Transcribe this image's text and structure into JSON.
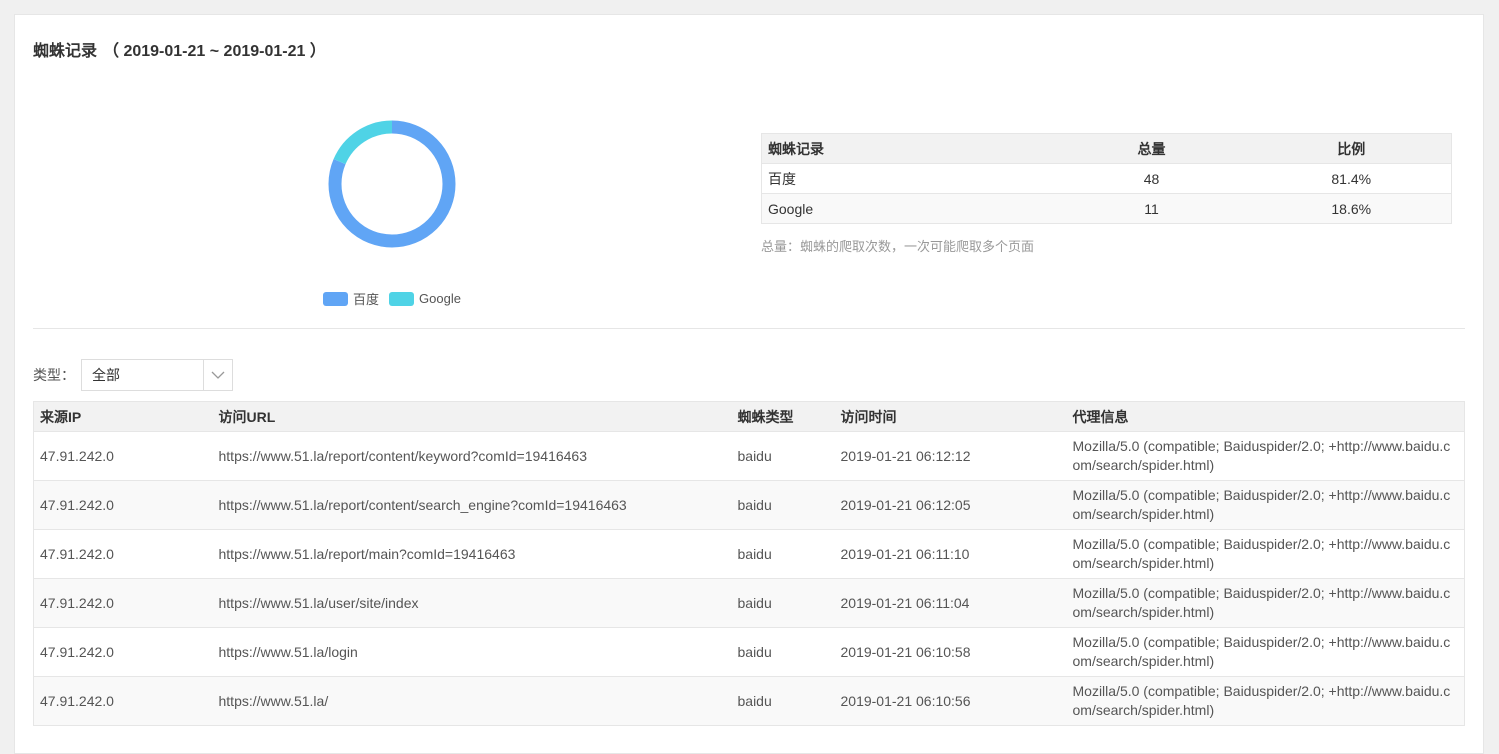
{
  "header": {
    "title": "蜘蛛记录",
    "date_range": "（ 2019-01-21 ~ 2019-01-21 ）"
  },
  "chart_data": {
    "type": "pie",
    "donut": true,
    "categories": [
      "百度",
      "Google"
    ],
    "values": [
      48,
      11
    ],
    "colors": [
      "#60a5f5",
      "#4fd3e6"
    ],
    "legend_position": "bottom"
  },
  "summary": {
    "headers": [
      "蜘蛛记录",
      "总量",
      "比例"
    ],
    "rows": [
      [
        "百度",
        "48",
        "81.4%"
      ],
      [
        "Google",
        "11",
        "18.6%"
      ]
    ],
    "note": "总量：蜘蛛的爬取次数，一次可能爬取多个页面"
  },
  "filter": {
    "label": "类型：",
    "selected": "全部"
  },
  "log": {
    "headers": [
      "来源IP",
      "访问URL",
      "蜘蛛类型",
      "访问时间",
      "代理信息"
    ],
    "rows": [
      [
        "47.91.242.0",
        "https://www.51.la/report/content/keyword?comId=19416463",
        "baidu",
        "2019-01-21 06:12:12",
        "Mozilla/5.0 (compatible; Baiduspider/2.0; +http://www.baidu.com/search/spider.html)"
      ],
      [
        "47.91.242.0",
        "https://www.51.la/report/content/search_engine?comId=19416463",
        "baidu",
        "2019-01-21 06:12:05",
        "Mozilla/5.0 (compatible; Baiduspider/2.0; +http://www.baidu.com/search/spider.html)"
      ],
      [
        "47.91.242.0",
        "https://www.51.la/report/main?comId=19416463",
        "baidu",
        "2019-01-21 06:11:10",
        "Mozilla/5.0 (compatible; Baiduspider/2.0; +http://www.baidu.com/search/spider.html)"
      ],
      [
        "47.91.242.0",
        "https://www.51.la/user/site/index",
        "baidu",
        "2019-01-21 06:11:04",
        "Mozilla/5.0 (compatible; Baiduspider/2.0; +http://www.baidu.com/search/spider.html)"
      ],
      [
        "47.91.242.0",
        "https://www.51.la/login",
        "baidu",
        "2019-01-21 06:10:58",
        "Mozilla/5.0 (compatible; Baiduspider/2.0; +http://www.baidu.com/search/spider.html)"
      ],
      [
        "47.91.242.0",
        "https://www.51.la/",
        "baidu",
        "2019-01-21 06:10:56",
        "Mozilla/5.0 (compatible; Baiduspider/2.0; +http://www.baidu.com/search/spider.html)"
      ]
    ]
  }
}
